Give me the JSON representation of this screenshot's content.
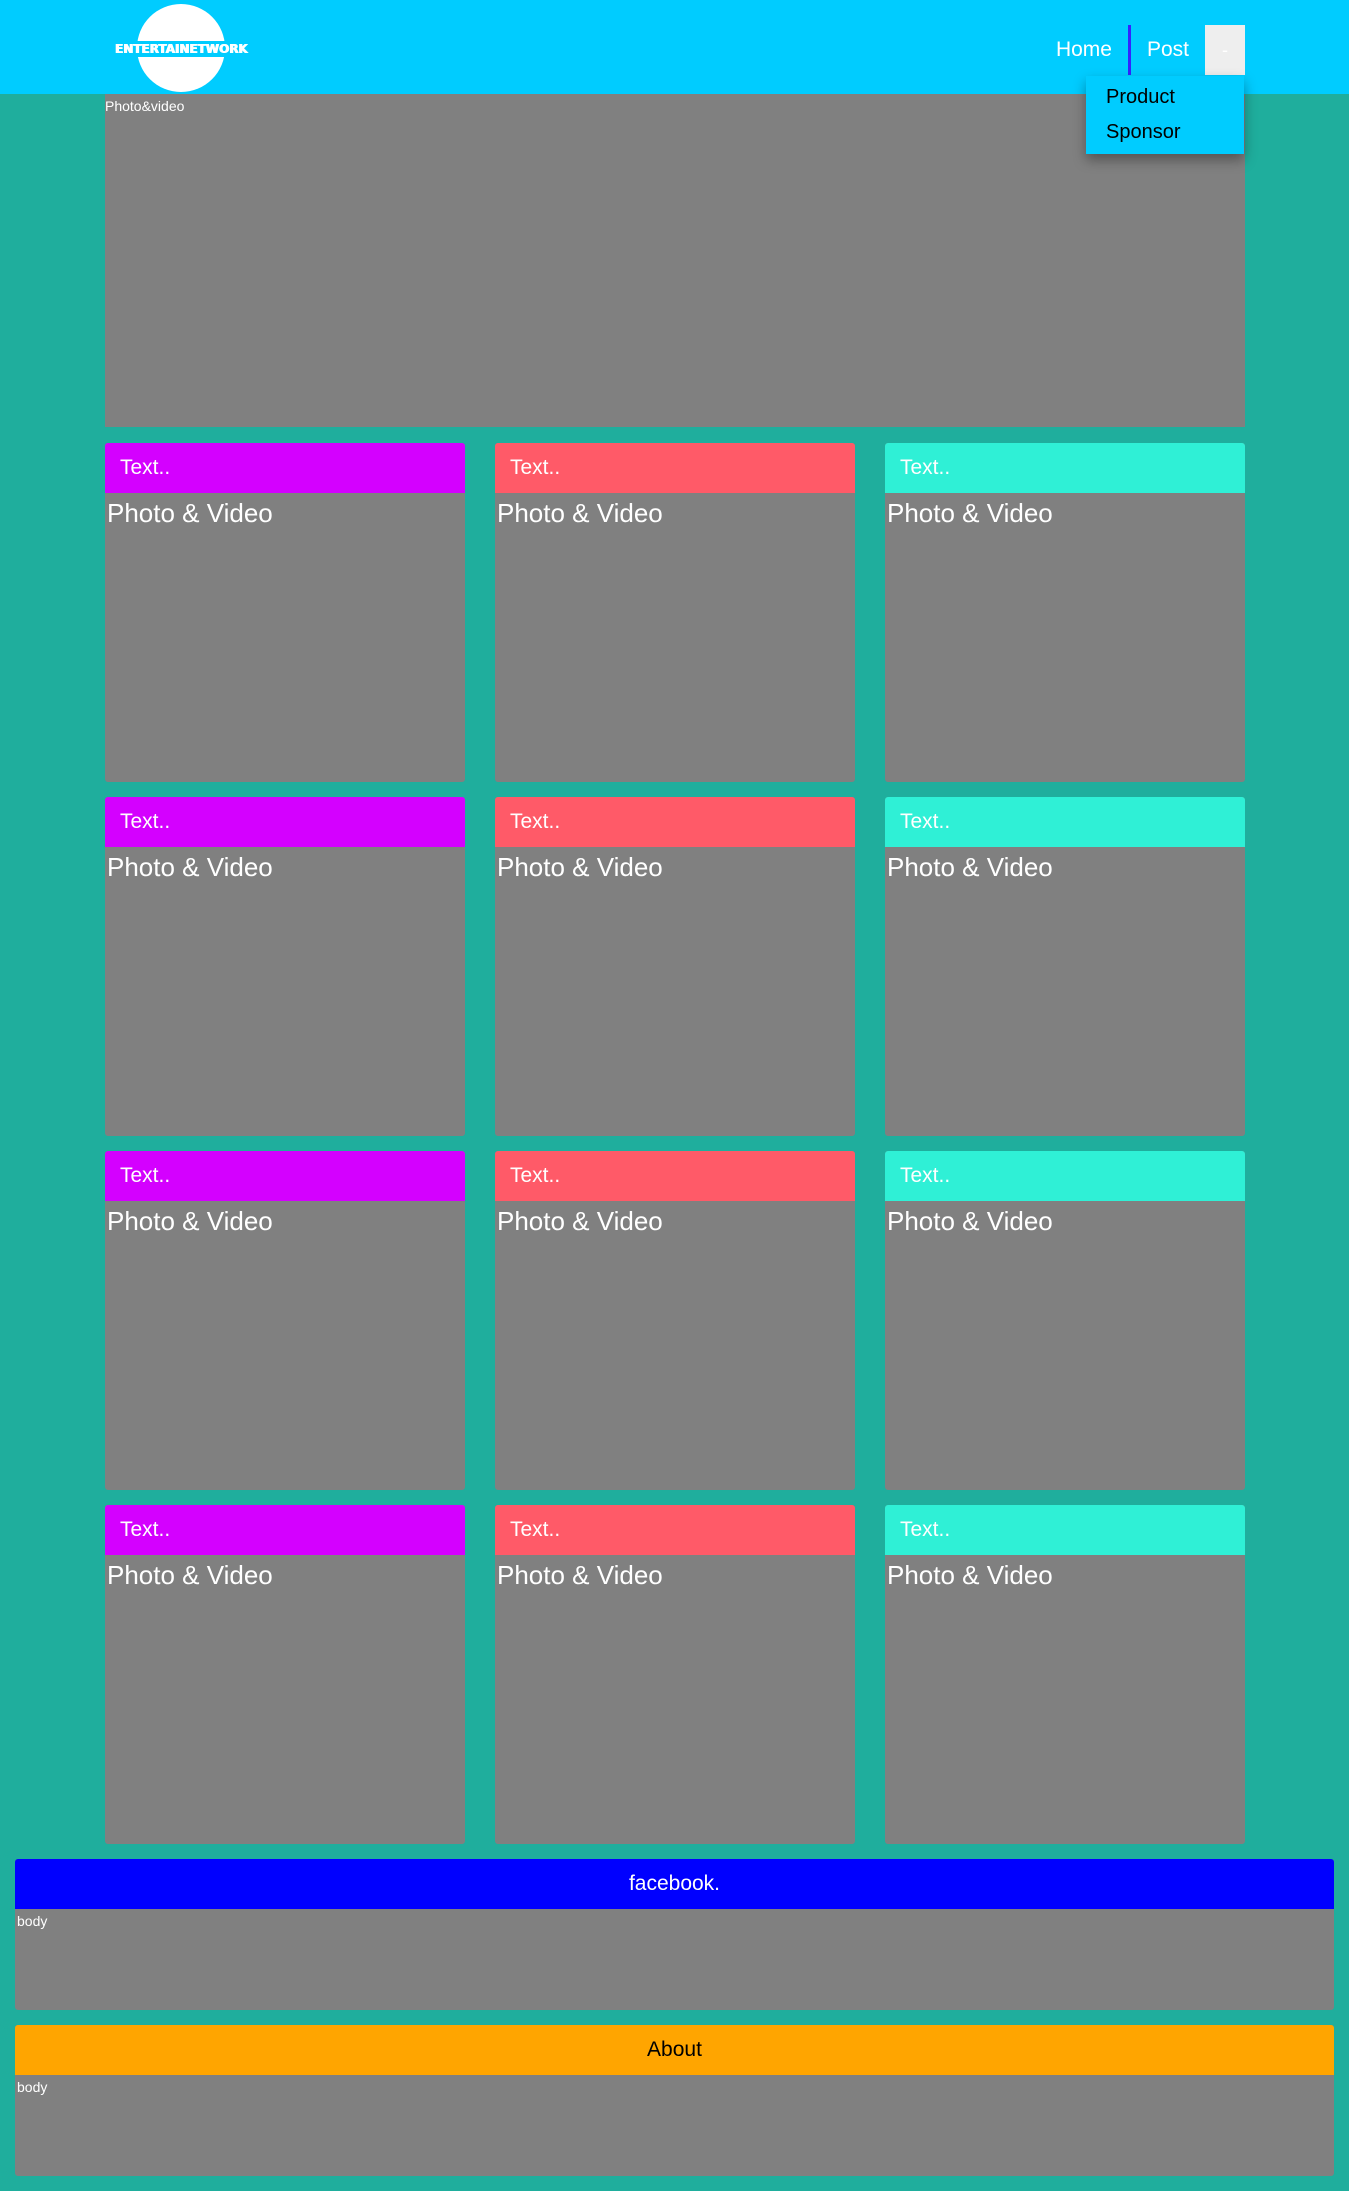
{
  "header": {
    "logo_text": "ENTERTAINETWORK",
    "nav": {
      "home": "Home",
      "post": "Post",
      "toggle": "-"
    },
    "dropdown": [
      "Product",
      "Sponsor"
    ],
    "colors": {
      "bar": "#00ccff",
      "separator": "#3322ff"
    }
  },
  "hero": {
    "label": "Photo&video"
  },
  "cards": {
    "header_text": "Text..",
    "body_text": "Photo & Video",
    "colors": [
      "#d400ff",
      "#ff5a68",
      "#2ff0d6"
    ],
    "rows": 4,
    "columns": 3
  },
  "panels": [
    {
      "title": "facebook.",
      "body": "body",
      "color": "#0000ff"
    },
    {
      "title": "About",
      "body": "body",
      "color": "#ffa500"
    }
  ]
}
